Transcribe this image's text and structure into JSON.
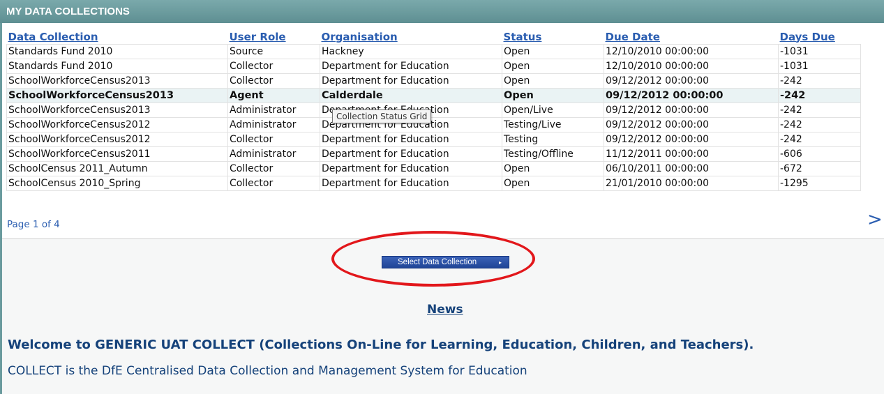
{
  "header": {
    "title": "MY DATA COLLECTIONS"
  },
  "table": {
    "columns": [
      "Data Collection",
      "User Role",
      "Organisation",
      "Status",
      "Due Date",
      "Days Due"
    ],
    "rows": [
      [
        "Standards Fund 2010",
        "Source",
        "Hackney",
        "Open",
        "12/10/2010 00:00:00",
        "-1031"
      ],
      [
        "Standards Fund 2010",
        "Collector",
        "Department for Education",
        "Open",
        "12/10/2010 00:00:00",
        "-1031"
      ],
      [
        "SchoolWorkforceCensus2013",
        "Collector",
        "Department for Education",
        "Open",
        "09/12/2012 00:00:00",
        "-242"
      ],
      [
        "SchoolWorkforceCensus2013",
        "Agent",
        "Calderdale",
        "Open",
        "09/12/2012 00:00:00",
        "-242"
      ],
      [
        "SchoolWorkforceCensus2013",
        "Administrator",
        "Department for Education",
        "Open/Live",
        "09/12/2012 00:00:00",
        "-242"
      ],
      [
        "SchoolWorkforceCensus2012",
        "Administrator",
        "Department for Education",
        "Testing/Live",
        "09/12/2012 00:00:00",
        "-242"
      ],
      [
        "SchoolWorkforceCensus2012",
        "Collector",
        "Department for Education",
        "Testing",
        "09/12/2012 00:00:00",
        "-242"
      ],
      [
        "SchoolWorkforceCensus2011",
        "Administrator",
        "Department for Education",
        "Testing/Offline",
        "11/12/2011 00:00:00",
        "-606"
      ],
      [
        "SchoolCensus 2011_Autumn",
        "Collector",
        "Department for Education",
        "Open",
        "06/10/2011 00:00:00",
        "-672"
      ],
      [
        "SchoolCensus 2010_Spring",
        "Collector",
        "Department for Education",
        "Open",
        "21/01/2010 00:00:00",
        "-1295"
      ]
    ]
  },
  "tooltip": "Collection Status Grid",
  "pager": {
    "info": "Page 1 of 4",
    "next": ">"
  },
  "select_button": {
    "label": "Select Data Collection",
    "arrow": "▸"
  },
  "news": {
    "title": "News",
    "welcome": "Welcome to GENERIC UAT COLLECT (Collections On-Line for Learning, Education, Children, and Teachers).",
    "description": "COLLECT is the DfE Centralised Data Collection and Management System for Education"
  },
  "colors": {
    "header": "#6a9b9e",
    "link": "#2a5db0",
    "button": "#2a4fa8",
    "highlight": "#e2171b",
    "news_text": "#15427a"
  }
}
